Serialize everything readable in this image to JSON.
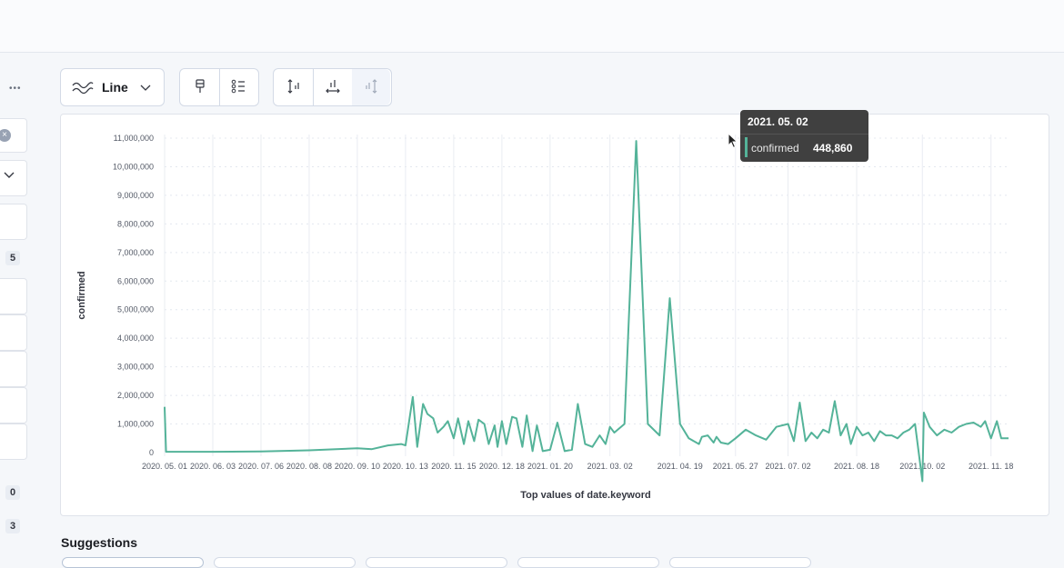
{
  "sidebar": {
    "badges": [
      "5",
      "0",
      "3"
    ]
  },
  "toolbar": {
    "chart_type_label": "Line",
    "icons": [
      "line-chart-icon",
      "paintbrush-icon",
      "legend-list-icon",
      "left-axis-icon",
      "bottom-axis-icon",
      "right-axis-icon"
    ]
  },
  "tooltip": {
    "title": "2021. 05. 02",
    "series_name": "confirmed",
    "value": "448,860",
    "color": "#54b399"
  },
  "suggestions": {
    "heading": "Suggestions"
  },
  "chart_data": {
    "type": "line",
    "ylabel": "confirmed",
    "xlabel": "Top values of date.keyword",
    "ylim": [
      0,
      11000000
    ],
    "y_ticks": [
      "0",
      "1,000,000",
      "2,000,000",
      "3,000,000",
      "4,000,000",
      "5,000,000",
      "6,000,000",
      "7,000,000",
      "8,000,000",
      "9,000,000",
      "10,000,000",
      "11,000,000"
    ],
    "x_ticks": [
      "2020. 05. 01",
      "2020. 06. 03",
      "2020. 07. 06",
      "2020. 08. 08",
      "2020. 09. 10",
      "2020. 10. 13",
      "2020. 11. 15",
      "2020. 12. 18",
      "2021. 01. 20",
      "2021. 03. 02",
      "2021. 04. 19",
      "2021. 05. 27",
      "2021. 07. 02",
      "2021. 08. 18",
      "2021. 10. 02",
      "2021. 11. 18"
    ],
    "grid": true,
    "color": "#54b399",
    "series": [
      {
        "name": "confirmed",
        "x": [
          "2020. 05. 01",
          "2020. 05. 02",
          "2020. 06. 03",
          "2020. 07. 06",
          "2020. 08. 08",
          "2020. 09. 10",
          "2020. 09. 20",
          "2020. 10. 01",
          "2020. 10. 10",
          "2020. 10. 13",
          "2020. 10. 18",
          "2020. 10. 21",
          "2020. 10. 25",
          "2020. 10. 28",
          "2020. 11. 01",
          "2020. 11. 04",
          "2020. 11. 08",
          "2020. 11. 11",
          "2020. 11. 15",
          "2020. 11. 18",
          "2020. 11. 22",
          "2020. 11. 25",
          "2020. 11. 29",
          "2020. 12. 02",
          "2020. 12. 06",
          "2020. 12. 09",
          "2020. 12. 13",
          "2020. 12. 15",
          "2020. 12. 18",
          "2020. 12. 21",
          "2020. 12. 25",
          "2020. 12. 28",
          "2021. 01. 01",
          "2021. 01. 04",
          "2021. 01. 08",
          "2021. 01. 11",
          "2021. 01. 15",
          "2021. 01. 20",
          "2021. 01. 25",
          "2021. 01. 30",
          "2021. 02. 04",
          "2021. 02. 08",
          "2021. 02. 13",
          "2021. 02. 18",
          "2021. 02. 23",
          "2021. 02. 27",
          "2021. 03. 02",
          "2021. 03. 05",
          "2021. 03. 12",
          "2021. 03. 20",
          "2021. 03. 28",
          "2021. 04. 05",
          "2021. 04. 12",
          "2021. 04. 19",
          "2021. 04. 25",
          "2021. 05. 02",
          "2021. 05. 04",
          "2021. 05. 08",
          "2021. 05. 12",
          "2021. 05. 14",
          "2021. 05. 17",
          "2021. 05. 22",
          "2021. 05. 27",
          "2021. 06. 03",
          "2021. 06. 10",
          "2021. 06. 17",
          "2021. 06. 24",
          "2021. 07. 02",
          "2021. 07. 06",
          "2021. 07. 10",
          "2021. 07. 14",
          "2021. 07. 18",
          "2021. 07. 22",
          "2021. 07. 26",
          "2021. 07. 30",
          "2021. 08. 03",
          "2021. 08. 07",
          "2021. 08. 11",
          "2021. 08. 14",
          "2021. 08. 18",
          "2021. 08. 22",
          "2021. 08. 26",
          "2021. 08. 30",
          "2021. 09. 03",
          "2021. 09. 07",
          "2021. 09. 11",
          "2021. 09. 15",
          "2021. 09. 19",
          "2021. 09. 23",
          "2021. 09. 27",
          "2021. 10. 02",
          "2021. 10. 03",
          "2021. 10. 07",
          "2021. 10. 12",
          "2021. 10. 17",
          "2021. 10. 22",
          "2021. 10. 27",
          "2021. 11. 01",
          "2021. 11. 06",
          "2021. 11. 11",
          "2021. 11. 14",
          "2021. 11. 18",
          "2021. 11. 22",
          "2021. 11. 25",
          "2021. 11. 30"
        ],
        "y": [
          1600000,
          30000,
          30000,
          40000,
          80000,
          150000,
          120000,
          250000,
          300000,
          250000,
          1950000,
          200000,
          1700000,
          1350000,
          1200000,
          700000,
          900000,
          1100000,
          500000,
          1200000,
          300000,
          1100000,
          400000,
          1150000,
          1000000,
          300000,
          950000,
          200000,
          1100000,
          300000,
          1250000,
          1200000,
          200000,
          1300000,
          50000,
          950000,
          50000,
          100000,
          1050000,
          50000,
          100000,
          1700000,
          300000,
          200000,
          600000,
          300000,
          900000,
          700000,
          1000000,
          10900000,
          1000000,
          600000,
          5400000,
          1000000,
          500000,
          300000,
          550000,
          600000,
          350000,
          550000,
          350000,
          300000,
          500000,
          800000,
          600000,
          450000,
          900000,
          1000000,
          400000,
          1750000,
          400000,
          700000,
          500000,
          800000,
          700000,
          1800000,
          600000,
          1000000,
          300000,
          900000,
          600000,
          700000,
          400000,
          750000,
          600000,
          600000,
          500000,
          700000,
          800000,
          1000000,
          -1000000,
          1400000,
          900000,
          600000,
          800000,
          700000,
          900000,
          1000000,
          1050000,
          900000,
          1100000,
          500000,
          1100000,
          500000,
          500000
        ]
      }
    ]
  }
}
